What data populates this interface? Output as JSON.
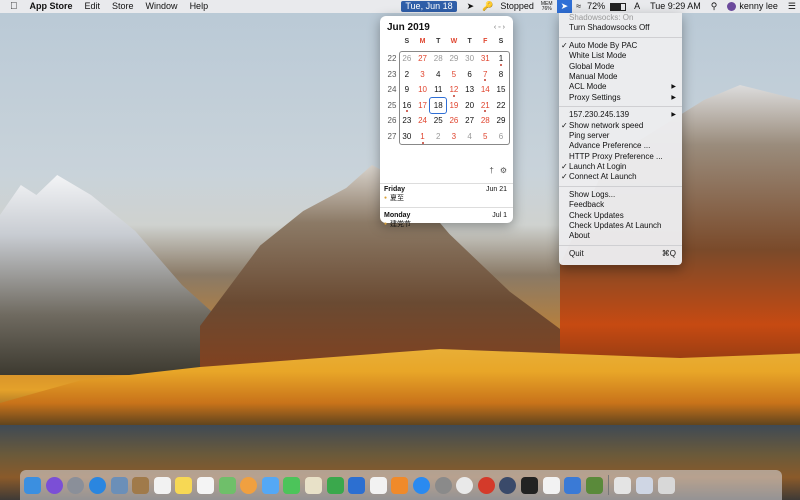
{
  "menubar": {
    "apple_icon": "apple-icon",
    "app_name": "App Store",
    "menus": [
      "Edit",
      "Store",
      "Window",
      "Help"
    ],
    "date_pill": "Tue, Jun 18",
    "vpn_status": "Stopped",
    "mem_label": "MEM",
    "mem_value": "76%",
    "battery_percent": "72%",
    "input_source": "A",
    "time": "Tue 9:29 AM",
    "user_name": "kenny lee"
  },
  "calendar": {
    "title": "Jun 2019",
    "weekdays": [
      "S",
      "M",
      "T",
      "W",
      "T",
      "F",
      "S"
    ],
    "weeks": [
      {
        "wn": "22",
        "days": [
          "26",
          "27",
          "28",
          "29",
          "30",
          "31",
          "1"
        ]
      },
      {
        "wn": "23",
        "days": [
          "2",
          "3",
          "4",
          "5",
          "6",
          "7",
          "8"
        ]
      },
      {
        "wn": "24",
        "days": [
          "9",
          "10",
          "11",
          "12",
          "13",
          "14",
          "15"
        ]
      },
      {
        "wn": "25",
        "days": [
          "16",
          "17",
          "18",
          "19",
          "20",
          "21",
          "22"
        ]
      },
      {
        "wn": "26",
        "days": [
          "23",
          "24",
          "25",
          "26",
          "27",
          "28",
          "29"
        ]
      },
      {
        "wn": "27",
        "days": [
          "30",
          "1",
          "2",
          "3",
          "4",
          "5",
          "6"
        ]
      }
    ],
    "events": [
      {
        "day": "Friday",
        "date": "Jun 21",
        "title": "夏至"
      },
      {
        "day": "Monday",
        "date": "Jul 1",
        "title": "建党节"
      }
    ]
  },
  "menu": {
    "status": "Shadowsocks: On",
    "toggle": "Turn Shadowsocks Off",
    "modes": [
      {
        "label": "Auto Mode By PAC",
        "checked": true
      },
      {
        "label": "White List Mode",
        "checked": false
      },
      {
        "label": "Global Mode",
        "checked": false
      },
      {
        "label": "Manual Mode",
        "checked": false
      }
    ],
    "acl_mode": "ACL Mode",
    "proxy_settings": "Proxy Settings",
    "server": "157.230.245.139",
    "show_speed": "Show network speed",
    "ping": "Ping server",
    "advance_pref": "Advance Preference ...",
    "http_pref": "HTTP Proxy Preference ...",
    "launch_login": "Launch At Login",
    "connect_launch": "Connect At Launch",
    "show_logs": "Show Logs...",
    "feedback": "Feedback",
    "check_updates": "Check Updates",
    "check_updates_launch": "Check Updates At Launch",
    "about": "About",
    "quit": "Quit",
    "quit_shortcut": "⌘Q"
  },
  "dock": {
    "apps": [
      {
        "name": "finder",
        "color": "#3b8fe0"
      },
      {
        "name": "siri",
        "color": "#7b4fd6"
      },
      {
        "name": "launchpad",
        "color": "#8a8f99"
      },
      {
        "name": "safari",
        "color": "#2a86e0"
      },
      {
        "name": "preview",
        "color": "#6b8fb8"
      },
      {
        "name": "notes-brown",
        "color": "#a07a4a"
      },
      {
        "name": "calendar",
        "color": "#f2f2f2"
      },
      {
        "name": "notes",
        "color": "#f7d854"
      },
      {
        "name": "reminders",
        "color": "#f4f4f4"
      },
      {
        "name": "maps",
        "color": "#6fbf6a"
      },
      {
        "name": "photos",
        "color": "#f0a040"
      },
      {
        "name": "messages-blue",
        "color": "#54a8f5"
      },
      {
        "name": "facetime",
        "color": "#4cc45a"
      },
      {
        "name": "notes-yellow",
        "color": "#e8e1c8"
      },
      {
        "name": "numbers",
        "color": "#3aa84c"
      },
      {
        "name": "keynote",
        "color": "#2c6fd1"
      },
      {
        "name": "music",
        "color": "#f2f2f2"
      },
      {
        "name": "books",
        "color": "#f08a2a"
      },
      {
        "name": "app-store",
        "color": "#2a8af0"
      },
      {
        "name": "system-preferences",
        "color": "#8a8a8a"
      },
      {
        "name": "chrome",
        "color": "#e9e9e9"
      },
      {
        "name": "app-red",
        "color": "#d43a2a"
      },
      {
        "name": "app-dark",
        "color": "#3a4a6a"
      },
      {
        "name": "terminal",
        "color": "#222222"
      },
      {
        "name": "textedit",
        "color": "#f2f2f2"
      },
      {
        "name": "app-blue",
        "color": "#3a7ad6"
      },
      {
        "name": "app-green",
        "color": "#5a8a3a"
      },
      {
        "name": "documents",
        "color": "#e4e4e4"
      },
      {
        "name": "downloads",
        "color": "#cfd6e4"
      },
      {
        "name": "trash",
        "color": "#d8d8d8"
      }
    ]
  }
}
